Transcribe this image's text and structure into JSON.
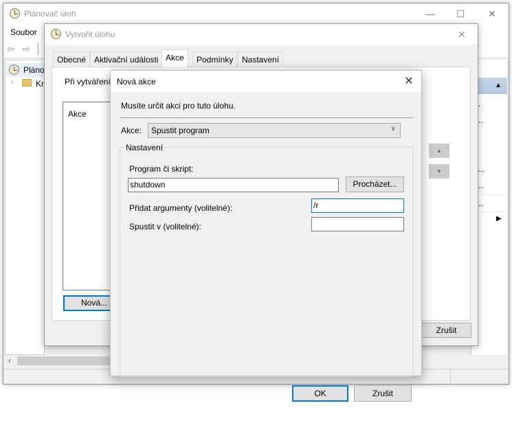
{
  "main_window": {
    "title": "Plánovač úloh",
    "menu": [
      "Soubor"
    ],
    "tree": {
      "root_label": "Plánov",
      "child_label": "Kn"
    },
    "right_panel_items": [
      "t...",
      "u...",
      "",
      "št...",
      "ú...",
      "b..."
    ],
    "window_buttons": {
      "minimize": "—",
      "maximize": "☐",
      "close": "✕"
    }
  },
  "create_task_dialog": {
    "title": "Vytvořit úlohu",
    "tabs": [
      {
        "label": "Obecné",
        "active": false
      },
      {
        "label": "Aktivační události",
        "active": false
      },
      {
        "label": "Akce",
        "active": true
      },
      {
        "label": "Podmínky",
        "active": false
      },
      {
        "label": "Nastavení",
        "active": false
      }
    ],
    "hint": "Při vytváření",
    "actions_list_header": "Akce",
    "new_button": "Nová...",
    "cancel_button": "Zrušit"
  },
  "new_action_dialog": {
    "title": "Nová akce",
    "instruction": "Musíte určit akci pro tuto úlohu.",
    "action_label": "Akce:",
    "action_value": "Spustit program",
    "settings_legend": "Nastavení",
    "program_label": "Program či skript:",
    "program_value": "shutdown",
    "browse_button": "Procházet...",
    "arguments_label": "Přidat argumenty (volitelné):",
    "arguments_value": "/r",
    "start_in_label": "Spustit v (volitelné):",
    "start_in_value": "",
    "ok_button": "OK",
    "cancel_button": "Zrušit"
  },
  "colors": {
    "accent": "#0078d7",
    "dialog_bg": "#f0f0f0",
    "selected_header": "#b3c9e2"
  }
}
